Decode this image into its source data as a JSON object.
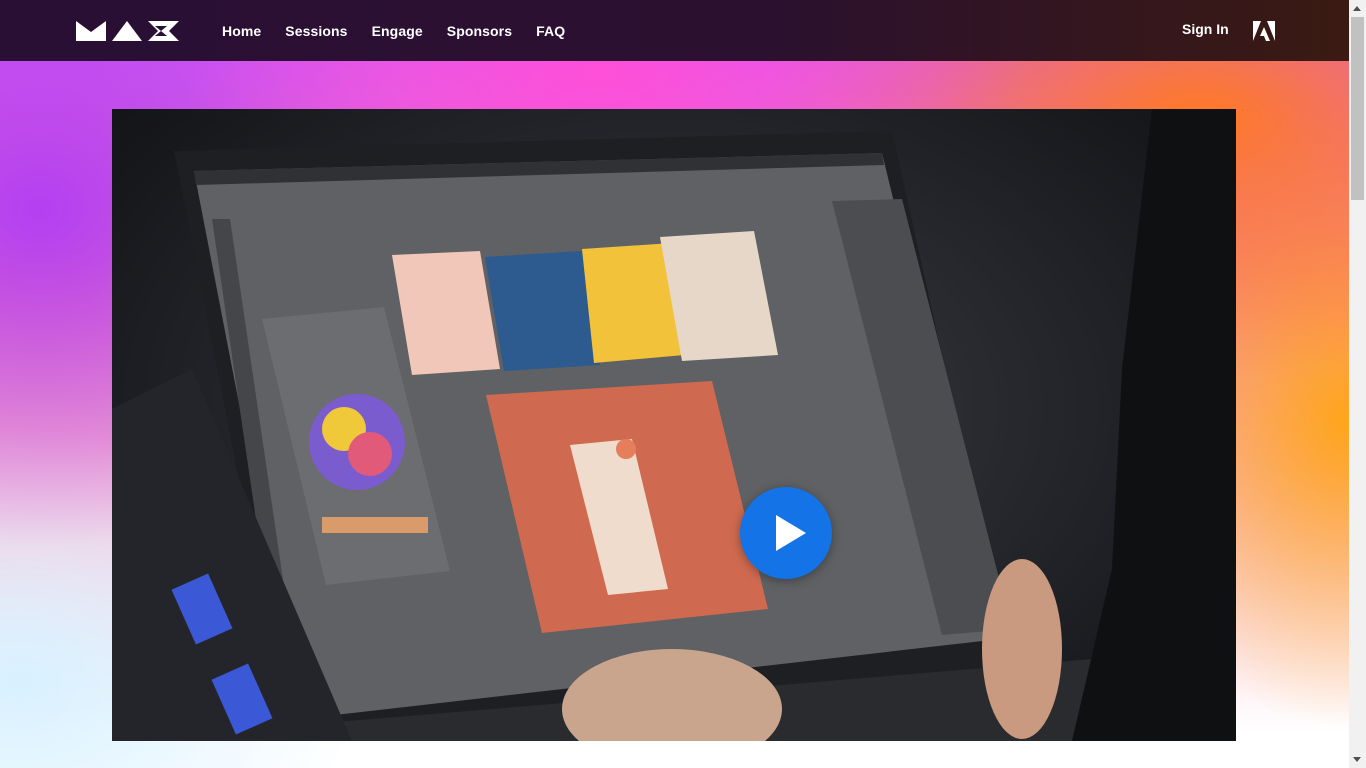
{
  "nav": {
    "logo_icon": "max-logo-icon",
    "links": [
      "Home",
      "Sessions",
      "Engage",
      "Sponsors",
      "FAQ"
    ],
    "sign_in": "Sign In",
    "adobe_icon": "adobe-logo-icon"
  },
  "video": {
    "play_icon": "play-icon"
  },
  "colors": {
    "nav_background": "#2a0f35",
    "play_button": "#1473e6",
    "gradient_pink": "#ff4fd8",
    "gradient_orange": "#ff7a22",
    "gradient_purple": "#b33ff2"
  }
}
